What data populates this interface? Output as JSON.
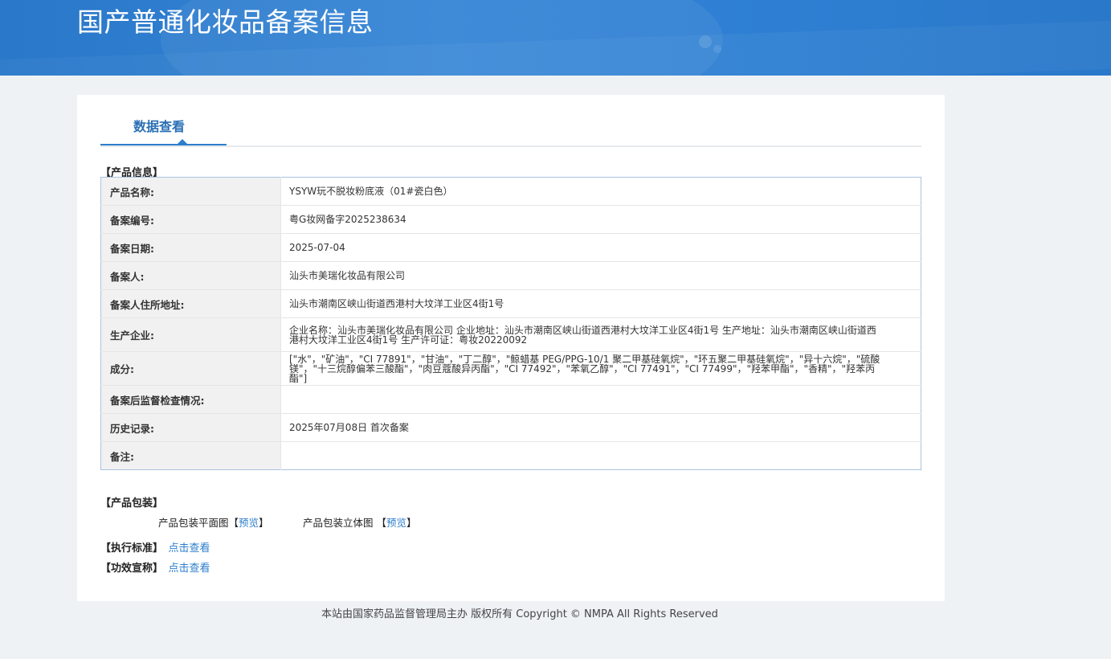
{
  "header": {
    "title": "国产普通化妆品备案信息"
  },
  "tabs": [
    {
      "label": "数据查看"
    }
  ],
  "product_info": {
    "section_label": "【产品信息】",
    "rows": [
      {
        "key": "产品名称:",
        "value": "YSYW玩不脱妆粉底液（01#瓷白色）"
      },
      {
        "key": "备案编号:",
        "value": "粤G妆网备字2025238634"
      },
      {
        "key": "备案日期:",
        "value": "2025-07-04"
      },
      {
        "key": "备案人:",
        "value": "汕头市美瑞化妆品有限公司"
      },
      {
        "key": "备案人住所地址:",
        "value": "汕头市潮南区峡山街道西港村大坟洋工业区4街1号"
      },
      {
        "key": "生产企业:",
        "value": "企业名称：汕头市美瑞化妆品有限公司 企业地址：汕头市潮南区峡山街道西港村大坟洋工业区4街1号 生产地址：汕头市潮南区峡山街道西港村大坟洋工业区4街1号 生产许可证：粤妆20220092"
      },
      {
        "key": "成分:",
        "value": "[\"水\"，\"矿油\"，\"CI 77891\"，\"甘油\"，\"丁二醇\"，\"鲸蜡基 PEG/PPG-10/1 聚二甲基硅氧烷\"，\"环五聚二甲基硅氧烷\"，\"异十六烷\"，\"硫酸镁\"，\"十三烷醇偏苯三酸酯\"，\"肉豆蔻酸异丙酯\"，\"CI 77492\"，\"苯氧乙醇\"，\"CI 77491\"，\"CI 77499\"，\"羟苯甲酯\"，\"香精\"，\"羟苯丙酯\"]"
      },
      {
        "key": "备案后监督检查情况:",
        "value": ""
      },
      {
        "key": "历史记录:",
        "value": "2025年07月08日 首次备案"
      },
      {
        "key": "备注:",
        "value": ""
      }
    ]
  },
  "packaging": {
    "section_label": "【产品包装】",
    "flat_label": "产品包装平面图",
    "stereo_label": "产品包装立体图",
    "bracket_open": "【",
    "bracket_close": "】",
    "preview_label": "预览"
  },
  "standard": {
    "label": "【执行标准】",
    "link": "点击查看"
  },
  "efficacy": {
    "label": "【功效宣称】",
    "link": "点击查看"
  },
  "footer": {
    "text": "本站由国家药品监督管理局主办 版权所有 Copyright © NMPA All Rights Reserved"
  },
  "colors": {
    "header_bg": "#2f80d2",
    "accent": "#2d7ecb",
    "page_bg": "#eef2f5"
  }
}
